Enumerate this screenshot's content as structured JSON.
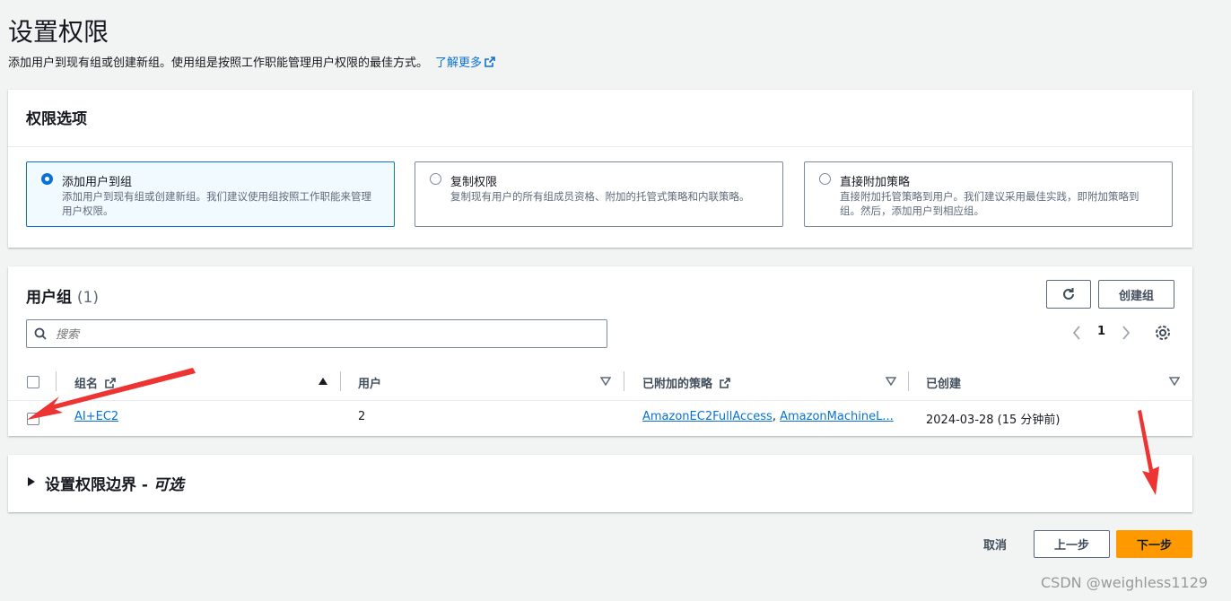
{
  "page": {
    "title": "设置权限",
    "description": "添加用户到现有组或创建新组。使用组是按照工作职能管理用户权限的最佳方式。",
    "learn_more": "了解更多"
  },
  "permission_options": {
    "title": "权限选项",
    "options": [
      {
        "label": "添加用户到组",
        "desc": "添加用户到现有组或创建新组。我们建议使用组按照工作职能来管理用户权限。",
        "selected": true
      },
      {
        "label": "复制权限",
        "desc": "复制现有用户的所有组成员资格、附加的托管式策略和内联策略。",
        "selected": false
      },
      {
        "label": "直接附加策略",
        "desc": "直接附加托管策略到用户。我们建议采用最佳实践，即附加策略到组。然后，添加用户到相应组。",
        "selected": false
      }
    ]
  },
  "groups": {
    "title": "用户组",
    "count": "(1)",
    "create_label": "创建组",
    "search_placeholder": "搜索",
    "page": "1",
    "columns": [
      "组名",
      "用户",
      "已附加的策略",
      "已创建"
    ],
    "rows": [
      {
        "name": "AI+EC2",
        "users": "2",
        "policy1": "AmazonEC2FullAccess",
        "policy2": "AmazonMachineL...",
        "created": "2024-03-28 (15 分钟前)"
      }
    ]
  },
  "boundary": {
    "title": "设置权限边界 - ",
    "optional": "可选"
  },
  "footer": {
    "cancel": "取消",
    "prev": "上一步",
    "next": "下一步"
  },
  "watermark": "CSDN @weighless1129",
  "colors": {
    "accent": "#0972d3",
    "primary_button": "#ff9900",
    "annotation": "#ee3333"
  }
}
